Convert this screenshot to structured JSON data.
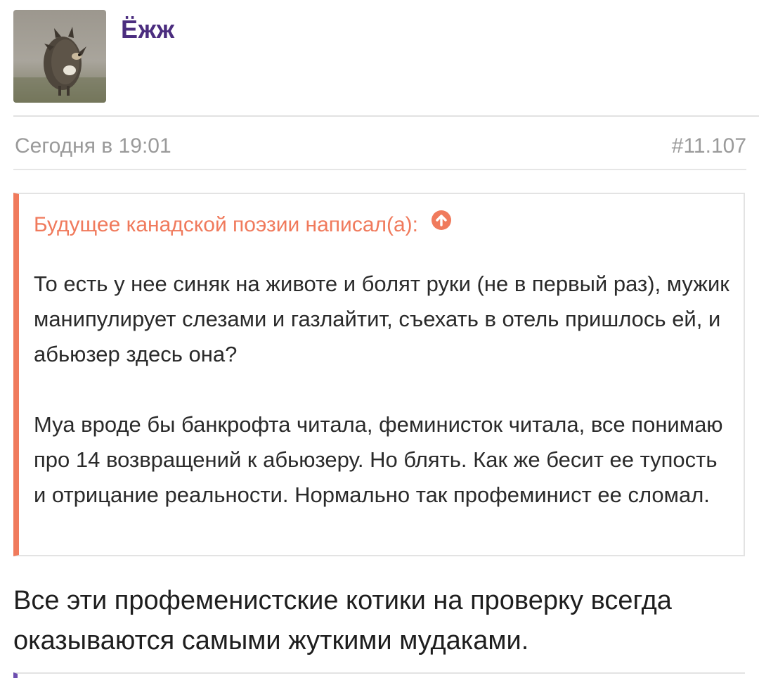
{
  "post": {
    "author": {
      "name": "Ёжж",
      "avatar_icon": "hedgehog-in-fog-avatar"
    },
    "timestamp": "Сегодня в 19:01",
    "post_number": "#11.107",
    "quote": {
      "header": "Будущее канадской поэзии написал(а):",
      "jump_icon": "arrow-up-circle-icon",
      "accent_color": "#f07a5c",
      "paragraphs": [
        "То есть у нее синяк на животе и болят руки (не в первый раз), мужик манипулирует слезами и газлайтит, съехать в отель пришлось ей, и абьюзер здесь она?",
        "Муа вроде бы банкрофта читала, феминисток читала, все понимаю про 14 возвращений к абьюзеру. Но блять. Как же бесит ее тупость и отрицание реальности. Нормально так профеминист ее сломал."
      ]
    },
    "body": "Все эти профеменистские котики на проверку всегда оказываются самыми жуткими мудаками."
  },
  "colors": {
    "username": "#4b2d7f",
    "meta_text": "#9a9a9a",
    "quote_accent": "#f07a5c",
    "next_quote_accent": "#6e4fb0"
  }
}
